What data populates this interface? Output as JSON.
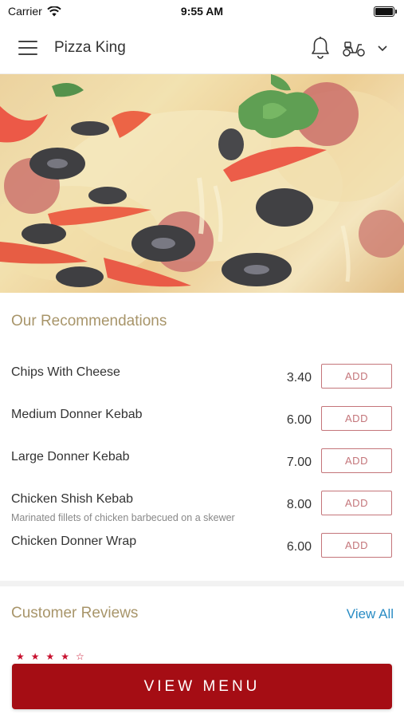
{
  "status_bar": {
    "carrier": "Carrier",
    "time": "9:55 AM"
  },
  "header": {
    "title": "Pizza King",
    "icons": [
      "menu-icon",
      "bell-icon",
      "scooter-icon",
      "chevron-down-icon"
    ]
  },
  "recommendations": {
    "title": "Our Recommendations",
    "items": [
      {
        "name": "Chips With Cheese",
        "description": "",
        "price": "3.40",
        "button": "ADD"
      },
      {
        "name": "Medium Donner Kebab",
        "description": "",
        "price": "6.00",
        "button": "ADD"
      },
      {
        "name": "Large Donner Kebab",
        "description": "",
        "price": "7.00",
        "button": "ADD"
      },
      {
        "name": "Chicken Shish Kebab",
        "description": "Marinated fillets of chicken barbecued on a skewer",
        "price": "8.00",
        "button": "ADD"
      },
      {
        "name": "Chicken Donner Wrap",
        "description": "",
        "price": "6.00",
        "button": "ADD"
      }
    ]
  },
  "reviews": {
    "title": "Customer Reviews",
    "view_all": "View All",
    "stars": "★★★★☆"
  },
  "footer": {
    "button": "VIEW MENU"
  },
  "colors": {
    "accent": "#a50d14",
    "add_border": "#c4757a",
    "section_title": "#a8956a",
    "link": "#2a8cc4"
  }
}
